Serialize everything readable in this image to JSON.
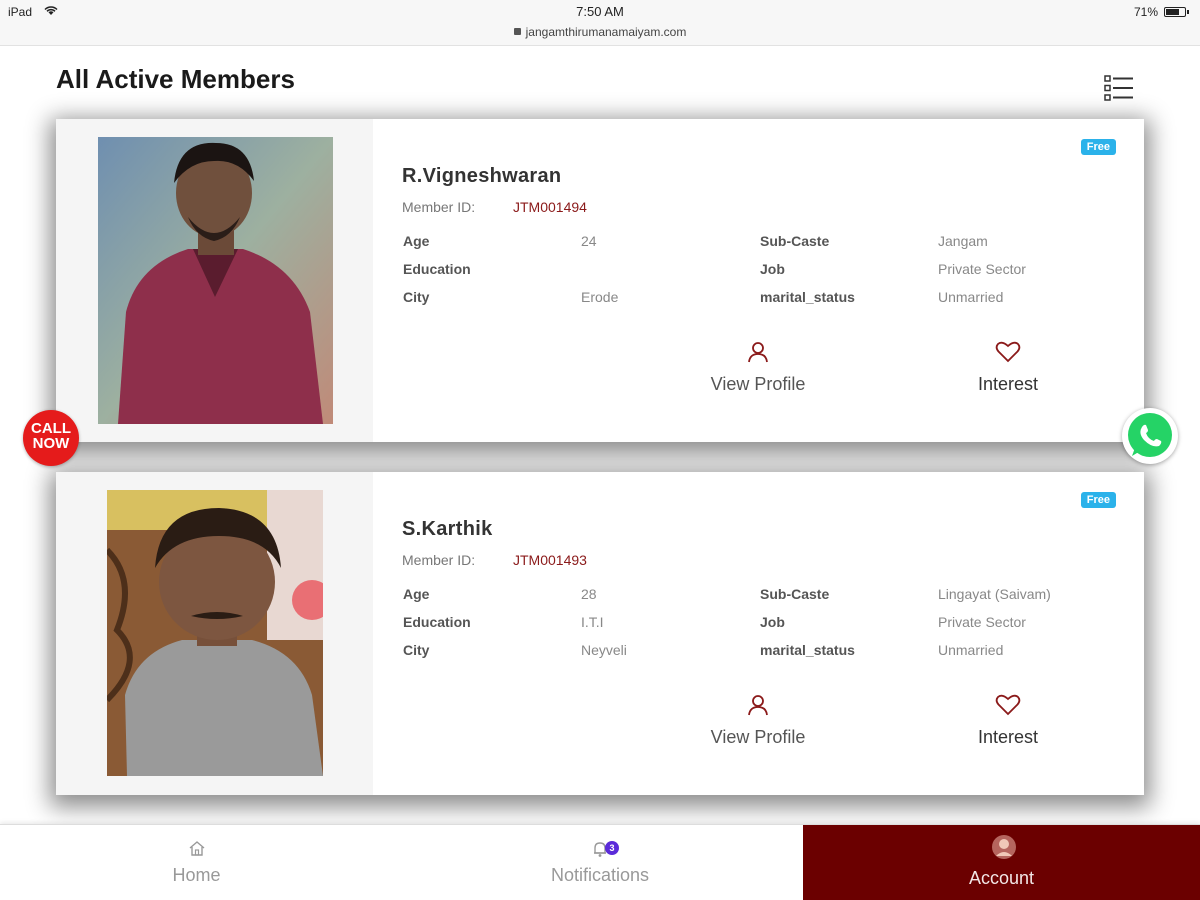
{
  "status_bar": {
    "device": "iPad",
    "time": "7:50 AM",
    "url": "jangamthirumanamaiyam.com",
    "battery": "71%"
  },
  "page": {
    "title": "All Active Members"
  },
  "labels": {
    "member_id": "Member ID:",
    "age": "Age",
    "education": "Education",
    "city": "City",
    "sub_caste": "Sub-Caste",
    "job": "Job",
    "marital_status": "marital_status",
    "view_profile": "View Profile",
    "interest": "Interest",
    "free_badge": "Free"
  },
  "members": [
    {
      "name": "R.Vigneshwaran",
      "member_id": "JTM001494",
      "age": "24",
      "education": "",
      "city": "Erode",
      "sub_caste": "Jangam",
      "job": "Private Sector",
      "marital_status": "Unmarried"
    },
    {
      "name": "S.Karthik",
      "member_id": "JTM001493",
      "age": "28",
      "education": "I.T.I",
      "city": "Neyveli",
      "sub_caste": "Lingayat (Saivam)",
      "job": "Private Sector",
      "marital_status": "Unmarried"
    }
  ],
  "floating": {
    "call_now": "CALL NOW"
  },
  "bottom_nav": {
    "home": "Home",
    "notifications": "Notifications",
    "notifications_count": "3",
    "account": "Account"
  },
  "colors": {
    "accent": "#6b0000",
    "member_id": "#8b1a1a",
    "badge": "#2bb2ea",
    "call_now": "#e51b1b",
    "whatsapp": "#25d366"
  }
}
